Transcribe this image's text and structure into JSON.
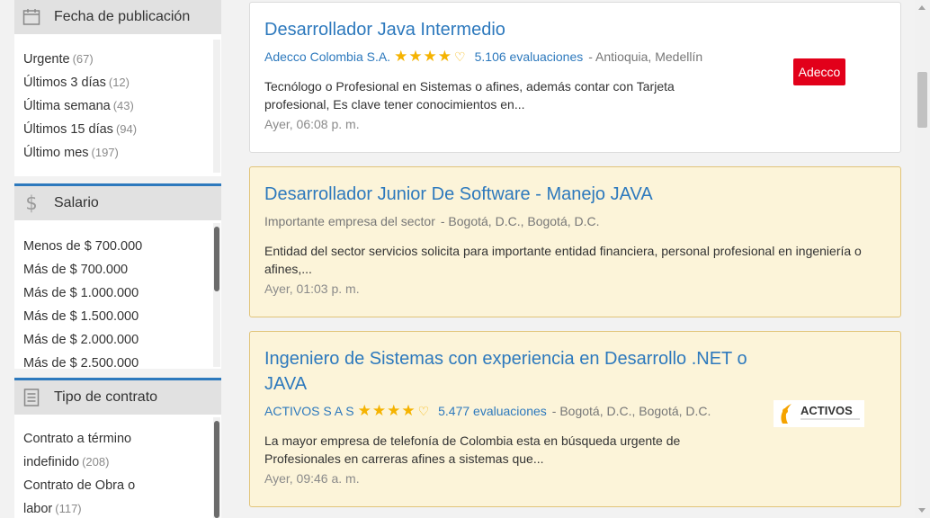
{
  "filters": {
    "fecha": {
      "title": "Fecha de publicación",
      "items": [
        {
          "label": "Urgente",
          "count": "(67)"
        },
        {
          "label": "Últimos 3 días",
          "count": "(12)"
        },
        {
          "label": "Última semana",
          "count": "(43)"
        },
        {
          "label": "Últimos 15 días",
          "count": "(94)"
        },
        {
          "label": "Último mes",
          "count": "(197)"
        }
      ]
    },
    "salario": {
      "title": "Salario",
      "items": [
        {
          "label": "Menos de $ 700.000"
        },
        {
          "label": "Más de $ 700.000"
        },
        {
          "label": "Más de $ 1.000.000"
        },
        {
          "label": "Más de $ 1.500.000"
        },
        {
          "label": "Más de $ 2.000.000"
        },
        {
          "label": "Más de $ 2.500.000"
        }
      ]
    },
    "contrato": {
      "title": "Tipo de contrato",
      "items": [
        {
          "line1": "Contrato a término",
          "line2": "indefinido",
          "count": "(208)"
        },
        {
          "line1": "Contrato de Obra o",
          "line2": "labor",
          "count": "(117)"
        }
      ]
    }
  },
  "jobs": [
    {
      "title": "Desarrollador Java Intermedio",
      "company": "Adecco Colombia S.A.",
      "stars": "★★★★",
      "heart": "♡",
      "evaluations": "5.106 evaluaciones",
      "location": "- Antioquia, Medellín",
      "description": "Tecnólogo o Profesional en Sistemas o afines, además contar con Tarjeta profesional, Es clave tener conocimientos en...",
      "date": "Ayer, 06:08 p. m.",
      "logo_text": "Adecco",
      "highlighted": false
    },
    {
      "title": "Desarrollador Junior De Software - Manejo JAVA",
      "company": "Importante empresa del sector",
      "location": "- Bogotá, D.C., Bogotá, D.C.",
      "description": "Entidad del sector servicios solicita para importante entidad financiera, personal profesional en ingeniería o afines,...",
      "date": "Ayer, 01:03 p. m.",
      "highlighted": true
    },
    {
      "title": "Ingeniero de Sistemas con experiencia en Desarrollo .NET o JAVA",
      "company": "ACTIVOS S A S",
      "stars": "★★★★",
      "heart": "♡",
      "evaluations": "5.477 evaluaciones",
      "location": "- Bogotá, D.C., Bogotá, D.C.",
      "description": "La mayor empresa de telefonía de Colombia esta en búsqueda urgente de Profesionales en carreras afines a sistemas que...",
      "date": "Ayer, 09:46 a. m.",
      "logo_text": "ACTIVOS",
      "highlighted": true
    }
  ],
  "colors": {
    "link": "#2d79bd",
    "star": "#f5b301",
    "highlight_bg": "#fcf4d9",
    "highlight_border": "#e1c47a",
    "adecco_red": "#e2001a"
  }
}
